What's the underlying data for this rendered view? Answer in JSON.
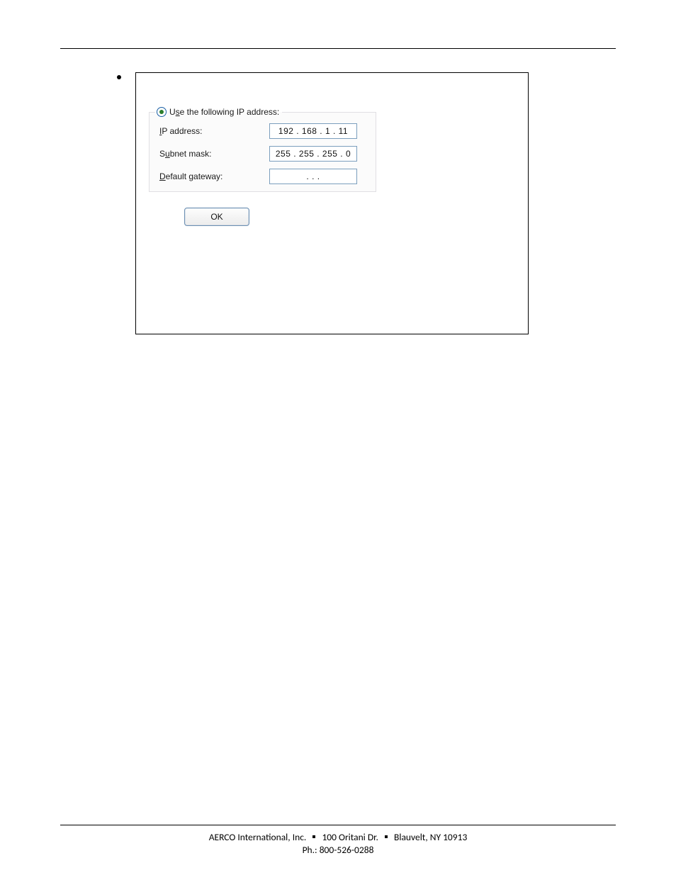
{
  "dialog": {
    "group_label_prefix": "U",
    "group_label_rest": "e the following IP address:",
    "group_underline_char": "s",
    "rows": [
      {
        "label_underline": "I",
        "label_rest": "P address:",
        "value": "192 . 168 .   1   .  11"
      },
      {
        "label_prefix": "S",
        "label_underline": "u",
        "label_rest": "bnet mask:",
        "value": "255 . 255 . 255 .   0"
      },
      {
        "label_underline": "D",
        "label_rest": "efault gateway:",
        "value": ".        .        ."
      }
    ],
    "ok_label": "OK"
  },
  "footer": {
    "company": "AERCO International, Inc.",
    "address": "100 Oritani Dr.",
    "city": "Blauvelt, NY 10913",
    "phone": "Ph.: 800-526-0288"
  }
}
